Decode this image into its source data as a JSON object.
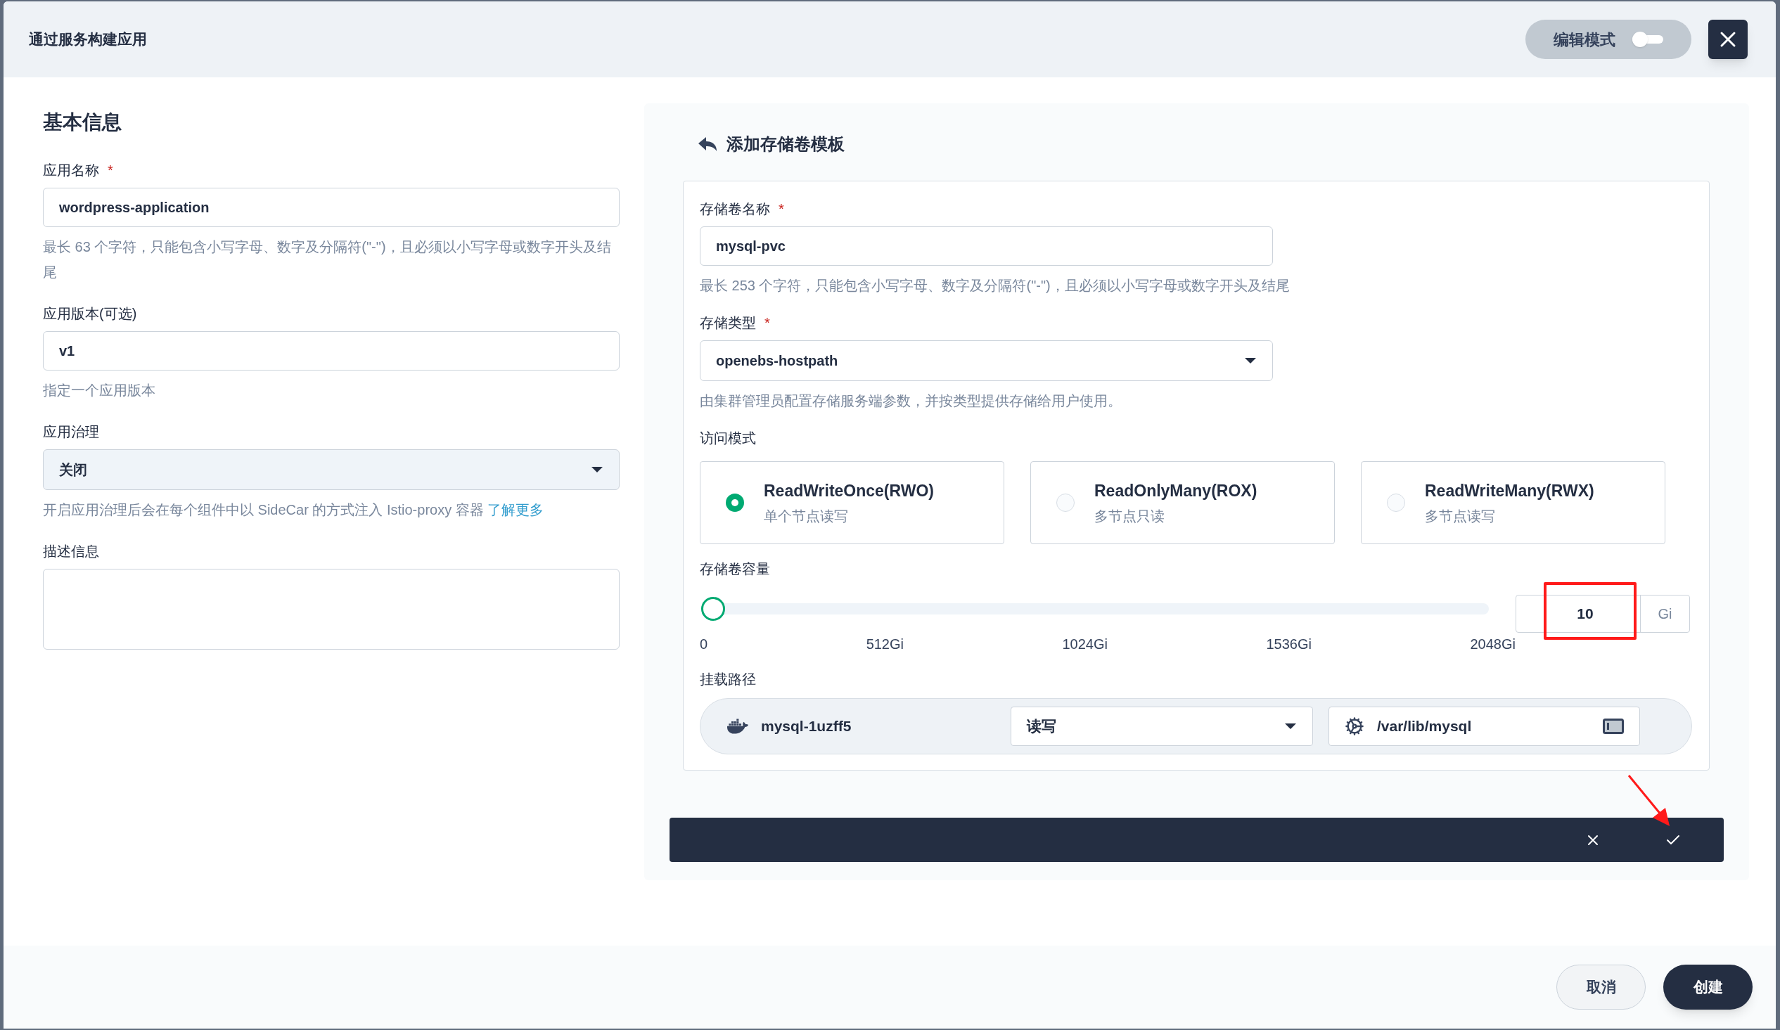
{
  "dialog": {
    "title": "通过服务构建应用",
    "edit_mode": {
      "label": "编辑模式",
      "on": false
    }
  },
  "basic_info": {
    "heading": "基本信息",
    "fields": [
      {
        "kind": "input",
        "label": "应用名称",
        "required_mark": "*",
        "value": "wordpress-application",
        "hint": "最长 63 个字符，只能包含小写字母、数字及分隔符(\"-\")，且必须以小写字母或数字开头及结尾"
      },
      {
        "kind": "input",
        "label": "应用版本(可选)",
        "value": "v1",
        "hint": "指定一个应用版本"
      },
      {
        "kind": "select",
        "label": "应用治理",
        "value": "关闭",
        "hint": "开启应用治理后会在每个组件中以 SideCar 的方式注入 Istio-proxy 容器",
        "link": "了解更多"
      },
      {
        "kind": "textarea",
        "label": "描述信息"
      }
    ]
  },
  "volume_template": {
    "heading": "添加存储卷模板",
    "fields": [
      {
        "kind": "input",
        "label": "存储卷名称",
        "required_mark": "*",
        "value": "mysql-pvc",
        "hint": "最长 253 个字符，只能包含小写字母、数字及分隔符(\"-\")，且必须以小写字母或数字开头及结尾"
      },
      {
        "kind": "select",
        "label": "存储类型",
        "required_mark": "*",
        "value": "openebs-hostpath",
        "hint": "由集群管理员配置存储服务端参数，并按类型提供存储给用户使用。"
      }
    ],
    "access_mode": {
      "label": "访问模式",
      "options": [
        {
          "title": "ReadWriteOnce(RWO)",
          "subtitle": "单个节点读写",
          "selected": true
        },
        {
          "title": "ReadOnlyMany(ROX)",
          "subtitle": "多节点只读",
          "selected": false
        },
        {
          "title": "ReadWriteMany(RWX)",
          "subtitle": "多节点读写",
          "selected": false
        }
      ]
    },
    "capacity": {
      "label": "存储卷容量",
      "level": 0.005,
      "ticks": [
        "0",
        "512Gi",
        "1024Gi",
        "1536Gi",
        "2048Gi"
      ],
      "value": "10",
      "unit": "Gi",
      "annotated": true
    },
    "mount": {
      "label": "挂载路径",
      "container": "mysql-1uzff5",
      "mode": "读写",
      "path": "/var/lib/mysql"
    },
    "confirm_bar": {
      "annotated": true
    }
  },
  "footer": {
    "buttons": [
      {
        "label": "取消",
        "kind": "secondary"
      },
      {
        "label": "创建",
        "kind": "primary"
      }
    ]
  }
}
